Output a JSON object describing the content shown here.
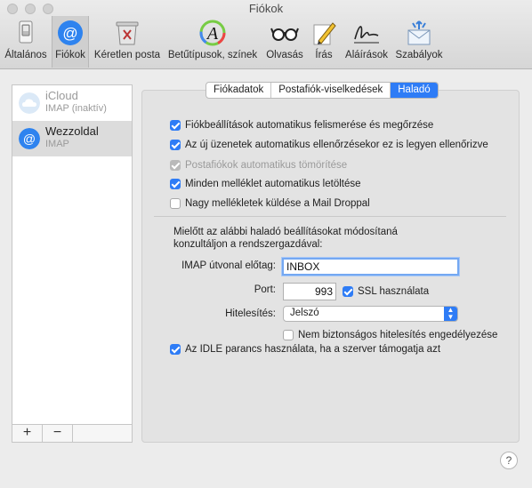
{
  "window": {
    "title": "Fiókok"
  },
  "toolbar": {
    "items": [
      {
        "label": "Általános",
        "icon": "switch-icon"
      },
      {
        "label": "Fiókok",
        "icon": "at-icon",
        "active": true
      },
      {
        "label": "Kéretlen posta",
        "icon": "junk-trash-icon"
      },
      {
        "label": "Betűtípusok, színek",
        "icon": "font-colors-icon"
      },
      {
        "label": "Olvasás",
        "icon": "glasses-icon"
      },
      {
        "label": "Írás",
        "icon": "pencil-icon"
      },
      {
        "label": "Aláírások",
        "icon": "signature-icon"
      },
      {
        "label": "Szabályok",
        "icon": "rules-icon"
      }
    ]
  },
  "accounts": [
    {
      "name": "iCloud",
      "type": "IMAP (inaktív)",
      "icon": "cloud-icon"
    },
    {
      "name": "Wezzoldal",
      "type": "IMAP",
      "icon": "at-icon",
      "selected": true
    }
  ],
  "sidebar_footer": {
    "add": "+",
    "remove": "−"
  },
  "tabs": [
    {
      "label": "Fiókadatok"
    },
    {
      "label": "Postafiók-viselkedések"
    },
    {
      "label": "Haladó",
      "active": true
    }
  ],
  "options": [
    {
      "label": "Fiókbeállítások automatikus felismerése és megőrzése",
      "checked": true
    },
    {
      "label": "Az új üzenetek automatikus ellenőrzésekor ez is legyen ellenőrizve",
      "checked": true
    },
    {
      "label": "Postafiókok automatikus tömörítése",
      "checked": true,
      "disabled": true
    },
    {
      "label": "Minden melléklet automatikus letöltése",
      "checked": true
    },
    {
      "label": "Nagy mellékletek küldése a Mail Droppal",
      "checked": false
    }
  ],
  "advanced_note": "Mielőtt az alábbi haladó beállításokat módosítaná konzultáljon a rendszergazdával:",
  "imap_prefix": {
    "label": "IMAP útvonal előtag:",
    "value": "INBOX"
  },
  "port": {
    "label": "Port:",
    "value": "993"
  },
  "ssl": {
    "label": "SSL használata",
    "checked": true
  },
  "auth": {
    "label": "Hitelesítés:",
    "value": "Jelszó"
  },
  "insecure_auth": {
    "label": "Nem biztonságos hitelesítés engedélyezése",
    "checked": false
  },
  "idle": {
    "label": "Az IDLE parancs használata, ha a szerver támogatja azt",
    "checked": true
  },
  "help": {
    "label": "?"
  },
  "colors": {
    "accent": "#2e7cf6"
  }
}
